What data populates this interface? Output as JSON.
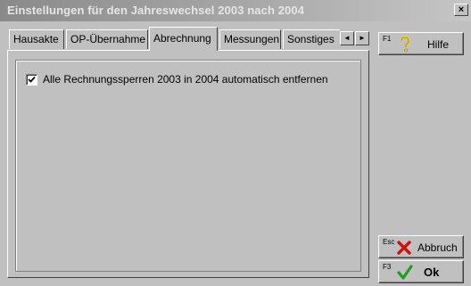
{
  "window": {
    "title": "Einstellungen für den Jahreswechsel 2003 nach 2004",
    "close_glyph": "×"
  },
  "tabs": [
    {
      "label": "Hausakte"
    },
    {
      "label": "OP-Übernahme"
    },
    {
      "label": "Abrechnung",
      "active": true
    },
    {
      "label": "Messungen"
    },
    {
      "label": "Sonstiges"
    }
  ],
  "tab_scroll": {
    "left": "◄",
    "right": "►"
  },
  "options": {
    "remove_invoice_locks": {
      "label": "Alle Rechnungssperren 2003 in 2004 automatisch entfernen",
      "checked": true
    }
  },
  "buttons": {
    "help": {
      "key": "F1",
      "label": "Hilfe"
    },
    "cancel": {
      "key": "Esc",
      "label": "Abbruch"
    },
    "ok": {
      "key": "F3",
      "label": "Ok"
    }
  },
  "colors": {
    "face": "#c0c0c0",
    "help_icon": "#f2d21a",
    "cancel_icon": "#d01010",
    "ok_icon": "#1aa01a"
  }
}
